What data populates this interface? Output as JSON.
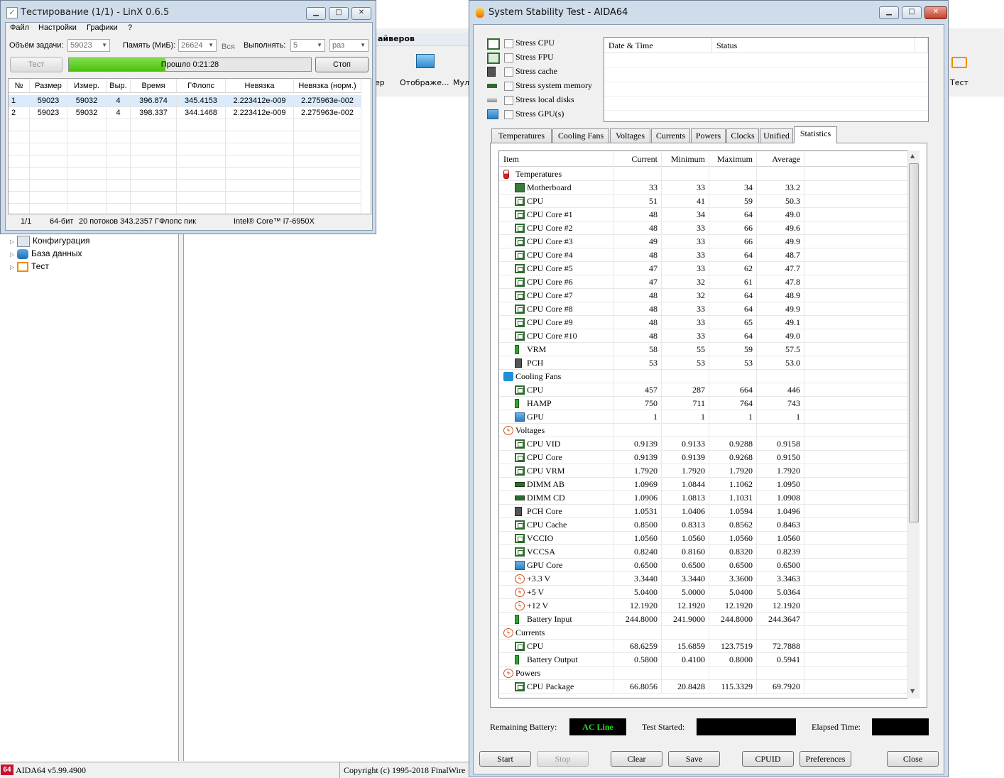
{
  "background_app": {
    "toolbar_partial": "айверов",
    "toolbar_items": [
      "ер",
      "Отображе...",
      "Мул",
      "Тест"
    ],
    "tree": [
      {
        "label": "Конфигурация",
        "icon": "config-icon"
      },
      {
        "label": "База данных",
        "icon": "database-icon"
      },
      {
        "label": "Тест",
        "icon": "test-icon"
      }
    ],
    "status_version": "AIDA64 v5.99.4900",
    "status_logo": "64",
    "status_copyright": "Copyright (c) 1995-2018 FinalWire"
  },
  "linx": {
    "title": "Тестирование (1/1) - LinX 0.6.5",
    "menu": [
      "Файл",
      "Настройки",
      "Графики",
      "?"
    ],
    "task_size_label": "Объём задачи:",
    "task_size_value": "59023",
    "memory_label": "Память (МиБ):",
    "memory_value": "26624",
    "memory_all": "Вся",
    "run_label": "Выполнять:",
    "run_value": "5",
    "run_unit": "раз",
    "test_button": "Тест",
    "stop_button": "Стоп",
    "progress_text": "Прошло 0:21:28",
    "progress_fraction": 0.4,
    "columns": [
      "№",
      "Размер",
      "Измер.",
      "Выр.",
      "Время",
      "ГФлопс",
      "Невязка",
      "Невязка (норм.)"
    ],
    "rows": [
      [
        "1",
        "59023",
        "59032",
        "4",
        "396.874",
        "345.4153",
        "2.223412e-009",
        "2.275963e-002"
      ],
      [
        "2",
        "59023",
        "59032",
        "4",
        "398.337",
        "344.1468",
        "2.223412e-009",
        "2.275963e-002"
      ]
    ],
    "status": {
      "pass": "1/1",
      "bits": "64-бит",
      "threads": "20 потоков 343.2357 ГФлопс пик",
      "cpu": "Intel® Core™ i7-6950X"
    }
  },
  "sst": {
    "title": "System Stability Test - AIDA64",
    "stress": [
      {
        "label": "Stress CPU",
        "icon": "cpu-chip-icon",
        "checked": false
      },
      {
        "label": "Stress FPU",
        "icon": "fpu-icon",
        "checked": false
      },
      {
        "label": "Stress cache",
        "icon": "cache-icon",
        "checked": false
      },
      {
        "label": "Stress system memory",
        "icon": "memory-icon",
        "checked": false
      },
      {
        "label": "Stress local disks",
        "icon": "disk-icon",
        "checked": false
      },
      {
        "label": "Stress GPU(s)",
        "icon": "gpu-icon",
        "checked": false
      }
    ],
    "log_headers": [
      "Date & Time",
      "Status"
    ],
    "tabs": [
      "Temperatures",
      "Cooling Fans",
      "Voltages",
      "Currents",
      "Powers",
      "Clocks",
      "Unified",
      "Statistics"
    ],
    "active_tab": "Statistics",
    "stat_headers": [
      "Item",
      "Current",
      "Minimum",
      "Maximum",
      "Average"
    ],
    "stat_rows": [
      {
        "type": "group",
        "label": "Temperatures",
        "icon": "therm"
      },
      {
        "label": "Motherboard",
        "icon": "board",
        "v": [
          "33",
          "33",
          "34",
          "33.2"
        ]
      },
      {
        "label": "CPU",
        "icon": "chip",
        "v": [
          "51",
          "41",
          "59",
          "50.3"
        ]
      },
      {
        "label": "CPU Core #1",
        "icon": "chip",
        "v": [
          "48",
          "34",
          "64",
          "49.0"
        ]
      },
      {
        "label": "CPU Core #2",
        "icon": "chip",
        "v": [
          "48",
          "33",
          "66",
          "49.6"
        ]
      },
      {
        "label": "CPU Core #3",
        "icon": "chip",
        "v": [
          "49",
          "33",
          "66",
          "49.9"
        ]
      },
      {
        "label": "CPU Core #4",
        "icon": "chip",
        "v": [
          "48",
          "33",
          "64",
          "48.7"
        ]
      },
      {
        "label": "CPU Core #5",
        "icon": "chip",
        "v": [
          "47",
          "33",
          "62",
          "47.7"
        ]
      },
      {
        "label": "CPU Core #6",
        "icon": "chip",
        "v": [
          "47",
          "32",
          "61",
          "47.8"
        ]
      },
      {
        "label": "CPU Core #7",
        "icon": "chip",
        "v": [
          "48",
          "32",
          "64",
          "48.9"
        ]
      },
      {
        "label": "CPU Core #8",
        "icon": "chip",
        "v": [
          "48",
          "33",
          "64",
          "49.9"
        ]
      },
      {
        "label": "CPU Core #9",
        "icon": "chip",
        "v": [
          "48",
          "33",
          "65",
          "49.1"
        ]
      },
      {
        "label": "CPU Core #10",
        "icon": "chip",
        "v": [
          "48",
          "33",
          "64",
          "49.0"
        ]
      },
      {
        "label": "VRM",
        "icon": "batt",
        "v": [
          "58",
          "55",
          "59",
          "57.5"
        ]
      },
      {
        "label": "PCH",
        "icon": "dark",
        "v": [
          "53",
          "53",
          "53",
          "53.0"
        ]
      },
      {
        "type": "group",
        "label": "Cooling Fans",
        "icon": "fan"
      },
      {
        "label": "CPU",
        "icon": "chip",
        "v": [
          "457",
          "287",
          "664",
          "446"
        ]
      },
      {
        "label": "HAMP",
        "icon": "batt",
        "v": [
          "750",
          "711",
          "764",
          "743"
        ]
      },
      {
        "label": "GPU",
        "icon": "gpu",
        "v": [
          "1",
          "1",
          "1",
          "1"
        ]
      },
      {
        "type": "group",
        "label": "Voltages",
        "icon": "volt"
      },
      {
        "label": "CPU VID",
        "icon": "chip",
        "v": [
          "0.9139",
          "0.9133",
          "0.9288",
          "0.9158"
        ]
      },
      {
        "label": "CPU Core",
        "icon": "chip",
        "v": [
          "0.9139",
          "0.9139",
          "0.9268",
          "0.9150"
        ]
      },
      {
        "label": "CPU VRM",
        "icon": "chip",
        "v": [
          "1.7920",
          "1.7920",
          "1.7920",
          "1.7920"
        ]
      },
      {
        "label": "DIMM AB",
        "icon": "dimm",
        "v": [
          "1.0969",
          "1.0844",
          "1.1062",
          "1.0950"
        ]
      },
      {
        "label": "DIMM CD",
        "icon": "dimm",
        "v": [
          "1.0906",
          "1.0813",
          "1.1031",
          "1.0908"
        ]
      },
      {
        "label": "PCH Core",
        "icon": "dark",
        "v": [
          "1.0531",
          "1.0406",
          "1.0594",
          "1.0496"
        ]
      },
      {
        "label": "CPU Cache",
        "icon": "chip",
        "v": [
          "0.8500",
          "0.8313",
          "0.8562",
          "0.8463"
        ]
      },
      {
        "label": "VCCIO",
        "icon": "chip",
        "v": [
          "1.0560",
          "1.0560",
          "1.0560",
          "1.0560"
        ]
      },
      {
        "label": "VCCSA",
        "icon": "chip",
        "v": [
          "0.8240",
          "0.8160",
          "0.8320",
          "0.8239"
        ]
      },
      {
        "label": "GPU Core",
        "icon": "gpu",
        "v": [
          "0.6500",
          "0.6500",
          "0.6500",
          "0.6500"
        ]
      },
      {
        "label": "+3.3 V",
        "icon": "volt",
        "v": [
          "3.3440",
          "3.3440",
          "3.3600",
          "3.3463"
        ]
      },
      {
        "label": "+5 V",
        "icon": "volt",
        "v": [
          "5.0400",
          "5.0000",
          "5.0400",
          "5.0364"
        ]
      },
      {
        "label": "+12 V",
        "icon": "volt",
        "v": [
          "12.1920",
          "12.1920",
          "12.1920",
          "12.1920"
        ]
      },
      {
        "label": "Battery Input",
        "icon": "batt",
        "v": [
          "244.8000",
          "241.9000",
          "244.8000",
          "244.3647"
        ]
      },
      {
        "type": "group",
        "label": "Currents",
        "icon": "volt"
      },
      {
        "label": "CPU",
        "icon": "chip",
        "v": [
          "68.6259",
          "15.6859",
          "123.7519",
          "72.7888"
        ]
      },
      {
        "label": "Battery Output",
        "icon": "batt",
        "v": [
          "0.5800",
          "0.4100",
          "0.8000",
          "0.5941"
        ]
      },
      {
        "type": "group",
        "label": "Powers",
        "icon": "volt"
      },
      {
        "label": "CPU Package",
        "icon": "chip",
        "v": [
          "66.8056",
          "20.8428",
          "115.3329",
          "69.7920"
        ]
      }
    ],
    "remaining_battery_label": "Remaining Battery:",
    "remaining_battery_value": "AC Line",
    "test_started_label": "Test Started:",
    "elapsed_label": "Elapsed Time:",
    "buttons": {
      "start": "Start",
      "stop": "Stop",
      "clear": "Clear",
      "save": "Save",
      "cpuid": "CPUID",
      "preferences": "Preferences",
      "close": "Close"
    },
    "colors": {
      "ac_line": "#22e022",
      "progress": "#5ccf20"
    }
  }
}
